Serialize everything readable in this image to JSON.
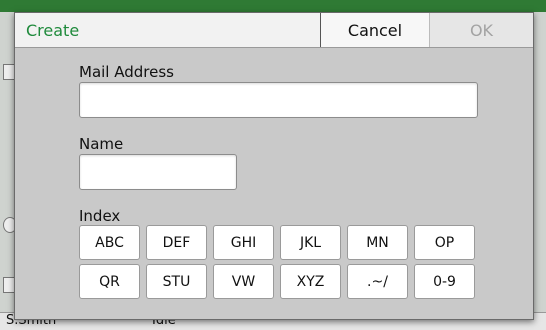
{
  "background": {
    "bottom_user": "S.Smith",
    "bottom_status": "Idle"
  },
  "dialog": {
    "title": "Create",
    "cancel_label": "Cancel",
    "ok_label": "OK",
    "mail_address_label": "Mail Address",
    "mail_address_value": "",
    "name_label": "Name",
    "name_value": "",
    "index_label": "Index",
    "index_keys": [
      "ABC",
      "DEF",
      "GHI",
      "JKL",
      "MN",
      "OP",
      "QR",
      "STU",
      "VW",
      "XYZ",
      ".~/",
      "0-9"
    ]
  },
  "colors": {
    "title": "#1f8a3c",
    "ok_disabled": "#a3a3a3",
    "dialog_body": "#c9c9c9"
  }
}
